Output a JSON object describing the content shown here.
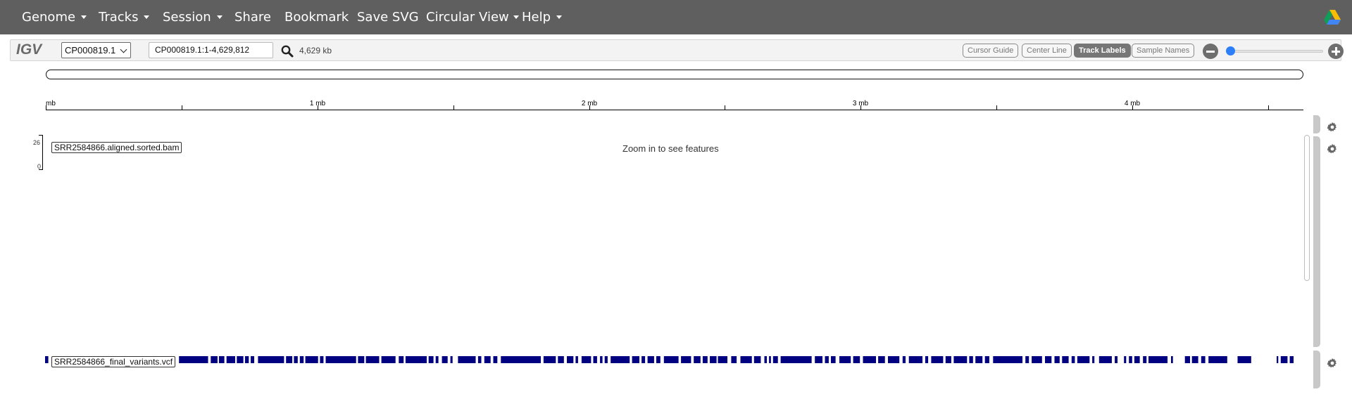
{
  "navbar": {
    "items": [
      {
        "label": "Genome",
        "dropdown": true
      },
      {
        "label": "Tracks",
        "dropdown": true
      },
      {
        "label": "Session",
        "dropdown": true
      },
      {
        "label": "Share",
        "dropdown": false
      },
      {
        "label": "Bookmark",
        "dropdown": false
      },
      {
        "label": "Save SVG",
        "dropdown": false
      },
      {
        "label": "Circular View",
        "dropdown": true
      },
      {
        "label": "Help",
        "dropdown": true
      }
    ],
    "background": "#5f5f5f",
    "right_icon": "google-drive-icon"
  },
  "toolbar": {
    "logo": "IGV",
    "chromosome": "CP000819.1",
    "locus": "CP000819.1:1-4,629,812",
    "search_icon": "search-icon",
    "width_label": "4,629 kb",
    "toggles": [
      {
        "label": "Cursor Guide",
        "active": false
      },
      {
        "label": "Center Line",
        "active": false
      },
      {
        "label": "Track Labels",
        "active": true
      },
      {
        "label": "Sample Names",
        "active": false
      }
    ],
    "zoom_out_icon": "minus-circle-icon",
    "zoom_in_icon": "plus-circle-icon",
    "zoom_level": 0
  },
  "ruler": {
    "genome_length": 4629812,
    "labels": [
      {
        "text": "mb",
        "position": 0
      },
      {
        "text": "1 mb",
        "position": 1000000
      },
      {
        "text": "2 mb",
        "position": 2000000
      },
      {
        "text": "3 mb",
        "position": 3000000
      },
      {
        "text": "4 mb",
        "position": 4000000
      }
    ],
    "ticks": [
      0,
      500000,
      1000000,
      1500000,
      2000000,
      2500000,
      3000000,
      3500000,
      4000000,
      4500000
    ]
  },
  "tracks": {
    "bam": {
      "label": "SRR2584866.aligned.sorted.bam",
      "max": "26",
      "min": "0",
      "message": "Zoom in to see features"
    },
    "vcf": {
      "label": "SRR2584866_final_variants.vcf",
      "color": "#000080",
      "variant_spans": [
        [
          0,
          12000
        ],
        [
          493000,
          600000
        ],
        [
          610000,
          635000
        ],
        [
          640000,
          660000
        ],
        [
          668000,
          700000
        ],
        [
          706000,
          730000
        ],
        [
          736000,
          750000
        ],
        [
          757000,
          770000
        ],
        [
          784000,
          880000
        ],
        [
          887000,
          910000
        ],
        [
          916000,
          930000
        ],
        [
          938000,
          952000
        ],
        [
          958000,
          1005000
        ],
        [
          1012000,
          1025000
        ],
        [
          1033000,
          1145000
        ],
        [
          1152000,
          1175000
        ],
        [
          1181000,
          1230000
        ],
        [
          1238000,
          1290000
        ],
        [
          1302000,
          1320000
        ],
        [
          1327000,
          1405000
        ],
        [
          1412000,
          1430000
        ],
        [
          1438000,
          1448000
        ],
        [
          1461000,
          1482000
        ],
        [
          1492000,
          1500000
        ],
        [
          1520000,
          1585000
        ],
        [
          1594000,
          1606000
        ],
        [
          1617000,
          1640000
        ],
        [
          1650000,
          1665000
        ],
        [
          1678000,
          1825000
        ],
        [
          1835000,
          1880000
        ],
        [
          1888000,
          1910000
        ],
        [
          1921000,
          1945000
        ],
        [
          1953000,
          1962000
        ],
        [
          1975000,
          2010000
        ],
        [
          2018000,
          2032000
        ],
        [
          2043000,
          2052000
        ],
        [
          2060000,
          2071000
        ],
        [
          2082000,
          2152000
        ],
        [
          2161000,
          2188000
        ],
        [
          2196000,
          2209000
        ],
        [
          2218000,
          2242000
        ],
        [
          2250000,
          2265000
        ],
        [
          2278000,
          2332000
        ],
        [
          2341000,
          2378000
        ],
        [
          2388000,
          2413000
        ],
        [
          2421000,
          2439000
        ],
        [
          2447000,
          2472000
        ],
        [
          2477000,
          2512000
        ],
        [
          2526000,
          2546000
        ],
        [
          2560000,
          2602000
        ],
        [
          2610000,
          2635000
        ],
        [
          2648000,
          2657000
        ],
        [
          2665000,
          2672000
        ],
        [
          2680000,
          2698000
        ],
        [
          2708000,
          2822000
        ],
        [
          2834000,
          2862000
        ],
        [
          2871000,
          2885000
        ],
        [
          2893000,
          2910000
        ],
        [
          2924000,
          2966000
        ],
        [
          2975000,
          3000000
        ],
        [
          3011000,
          3059000
        ],
        [
          3067000,
          3092000
        ],
        [
          3103000,
          3145000
        ],
        [
          3157000,
          3168000
        ],
        [
          3180000,
          3230000
        ],
        [
          3240000,
          3251000
        ],
        [
          3262000,
          3306000
        ],
        [
          3315000,
          3336000
        ],
        [
          3345000,
          3394000
        ],
        [
          3402000,
          3416000
        ],
        [
          3425000,
          3451000
        ],
        [
          3460000,
          3476000
        ],
        [
          3490000,
          3598000
        ],
        [
          3609000,
          3622000
        ],
        [
          3632000,
          3670000
        ],
        [
          3681000,
          3705000
        ],
        [
          3716000,
          3735000
        ],
        [
          3744000,
          3768000
        ],
        [
          3779000,
          3791000
        ],
        [
          3800000,
          3845000
        ],
        [
          3855000,
          3863000
        ],
        [
          3880000,
          3927000
        ],
        [
          3938000,
          3948000
        ],
        [
          3972000,
          3980000
        ],
        [
          3990000,
          4002000
        ],
        [
          4010000,
          4030000
        ],
        [
          4042000,
          4055000
        ],
        [
          4062000,
          4132000
        ],
        [
          4145000,
          4152000
        ],
        [
          4196000,
          4215000
        ],
        [
          4222000,
          4245000
        ],
        [
          4256000,
          4271000
        ],
        [
          4283000,
          4352000
        ],
        [
          4390000,
          4440000
        ],
        [
          4534000,
          4540000
        ],
        [
          4549000,
          4574000
        ],
        [
          4582000,
          4596000
        ]
      ]
    }
  },
  "gear_icon": "gear-icon"
}
